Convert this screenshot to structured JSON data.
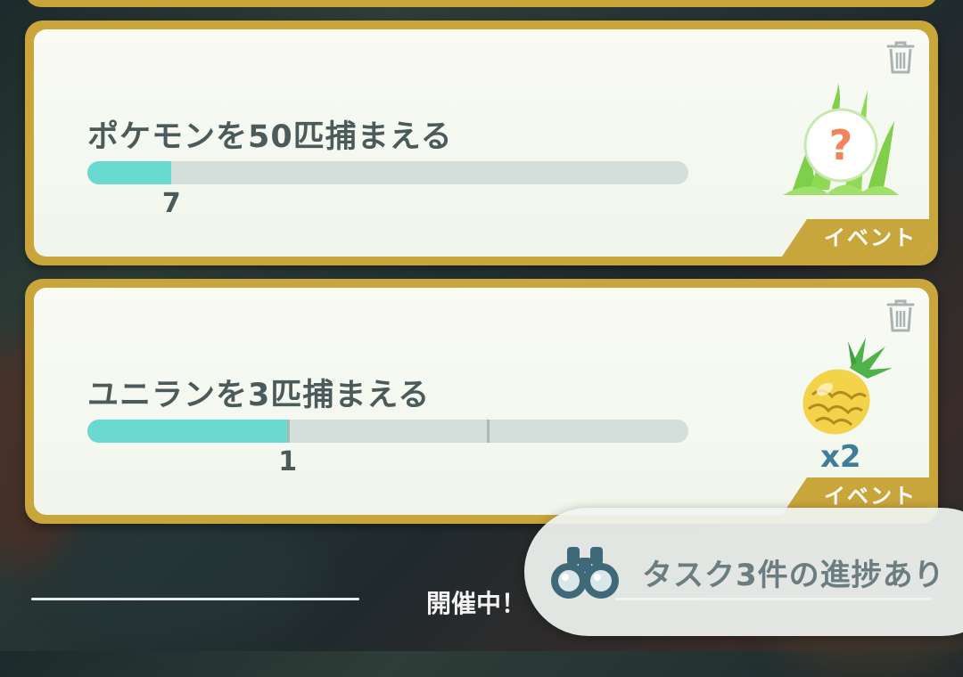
{
  "tasks": [
    {
      "title": "ポケモンを50匹捕まえる",
      "progress_current": 7,
      "progress_target": 50,
      "progress_label": "7",
      "reward_icon": "mystery-encounter-icon",
      "tag": "イベント"
    },
    {
      "title": "ユニランを3匹捕まえる",
      "progress_current": 1,
      "progress_target": 3,
      "progress_label": "1",
      "reward_icon": "golden-pinap-berry-icon",
      "reward_multiplier": "x2",
      "tag": "イベント"
    }
  ],
  "footer": {
    "label": "開催中！"
  },
  "toast": {
    "icon": "binoculars-icon",
    "text": "タスク3件の進捗あり"
  },
  "colors": {
    "card_border": "#c9a63c",
    "progress_fill": "#6ad9d0",
    "progress_track": "#d4dfdb",
    "multiplier": "#3f7e98"
  }
}
